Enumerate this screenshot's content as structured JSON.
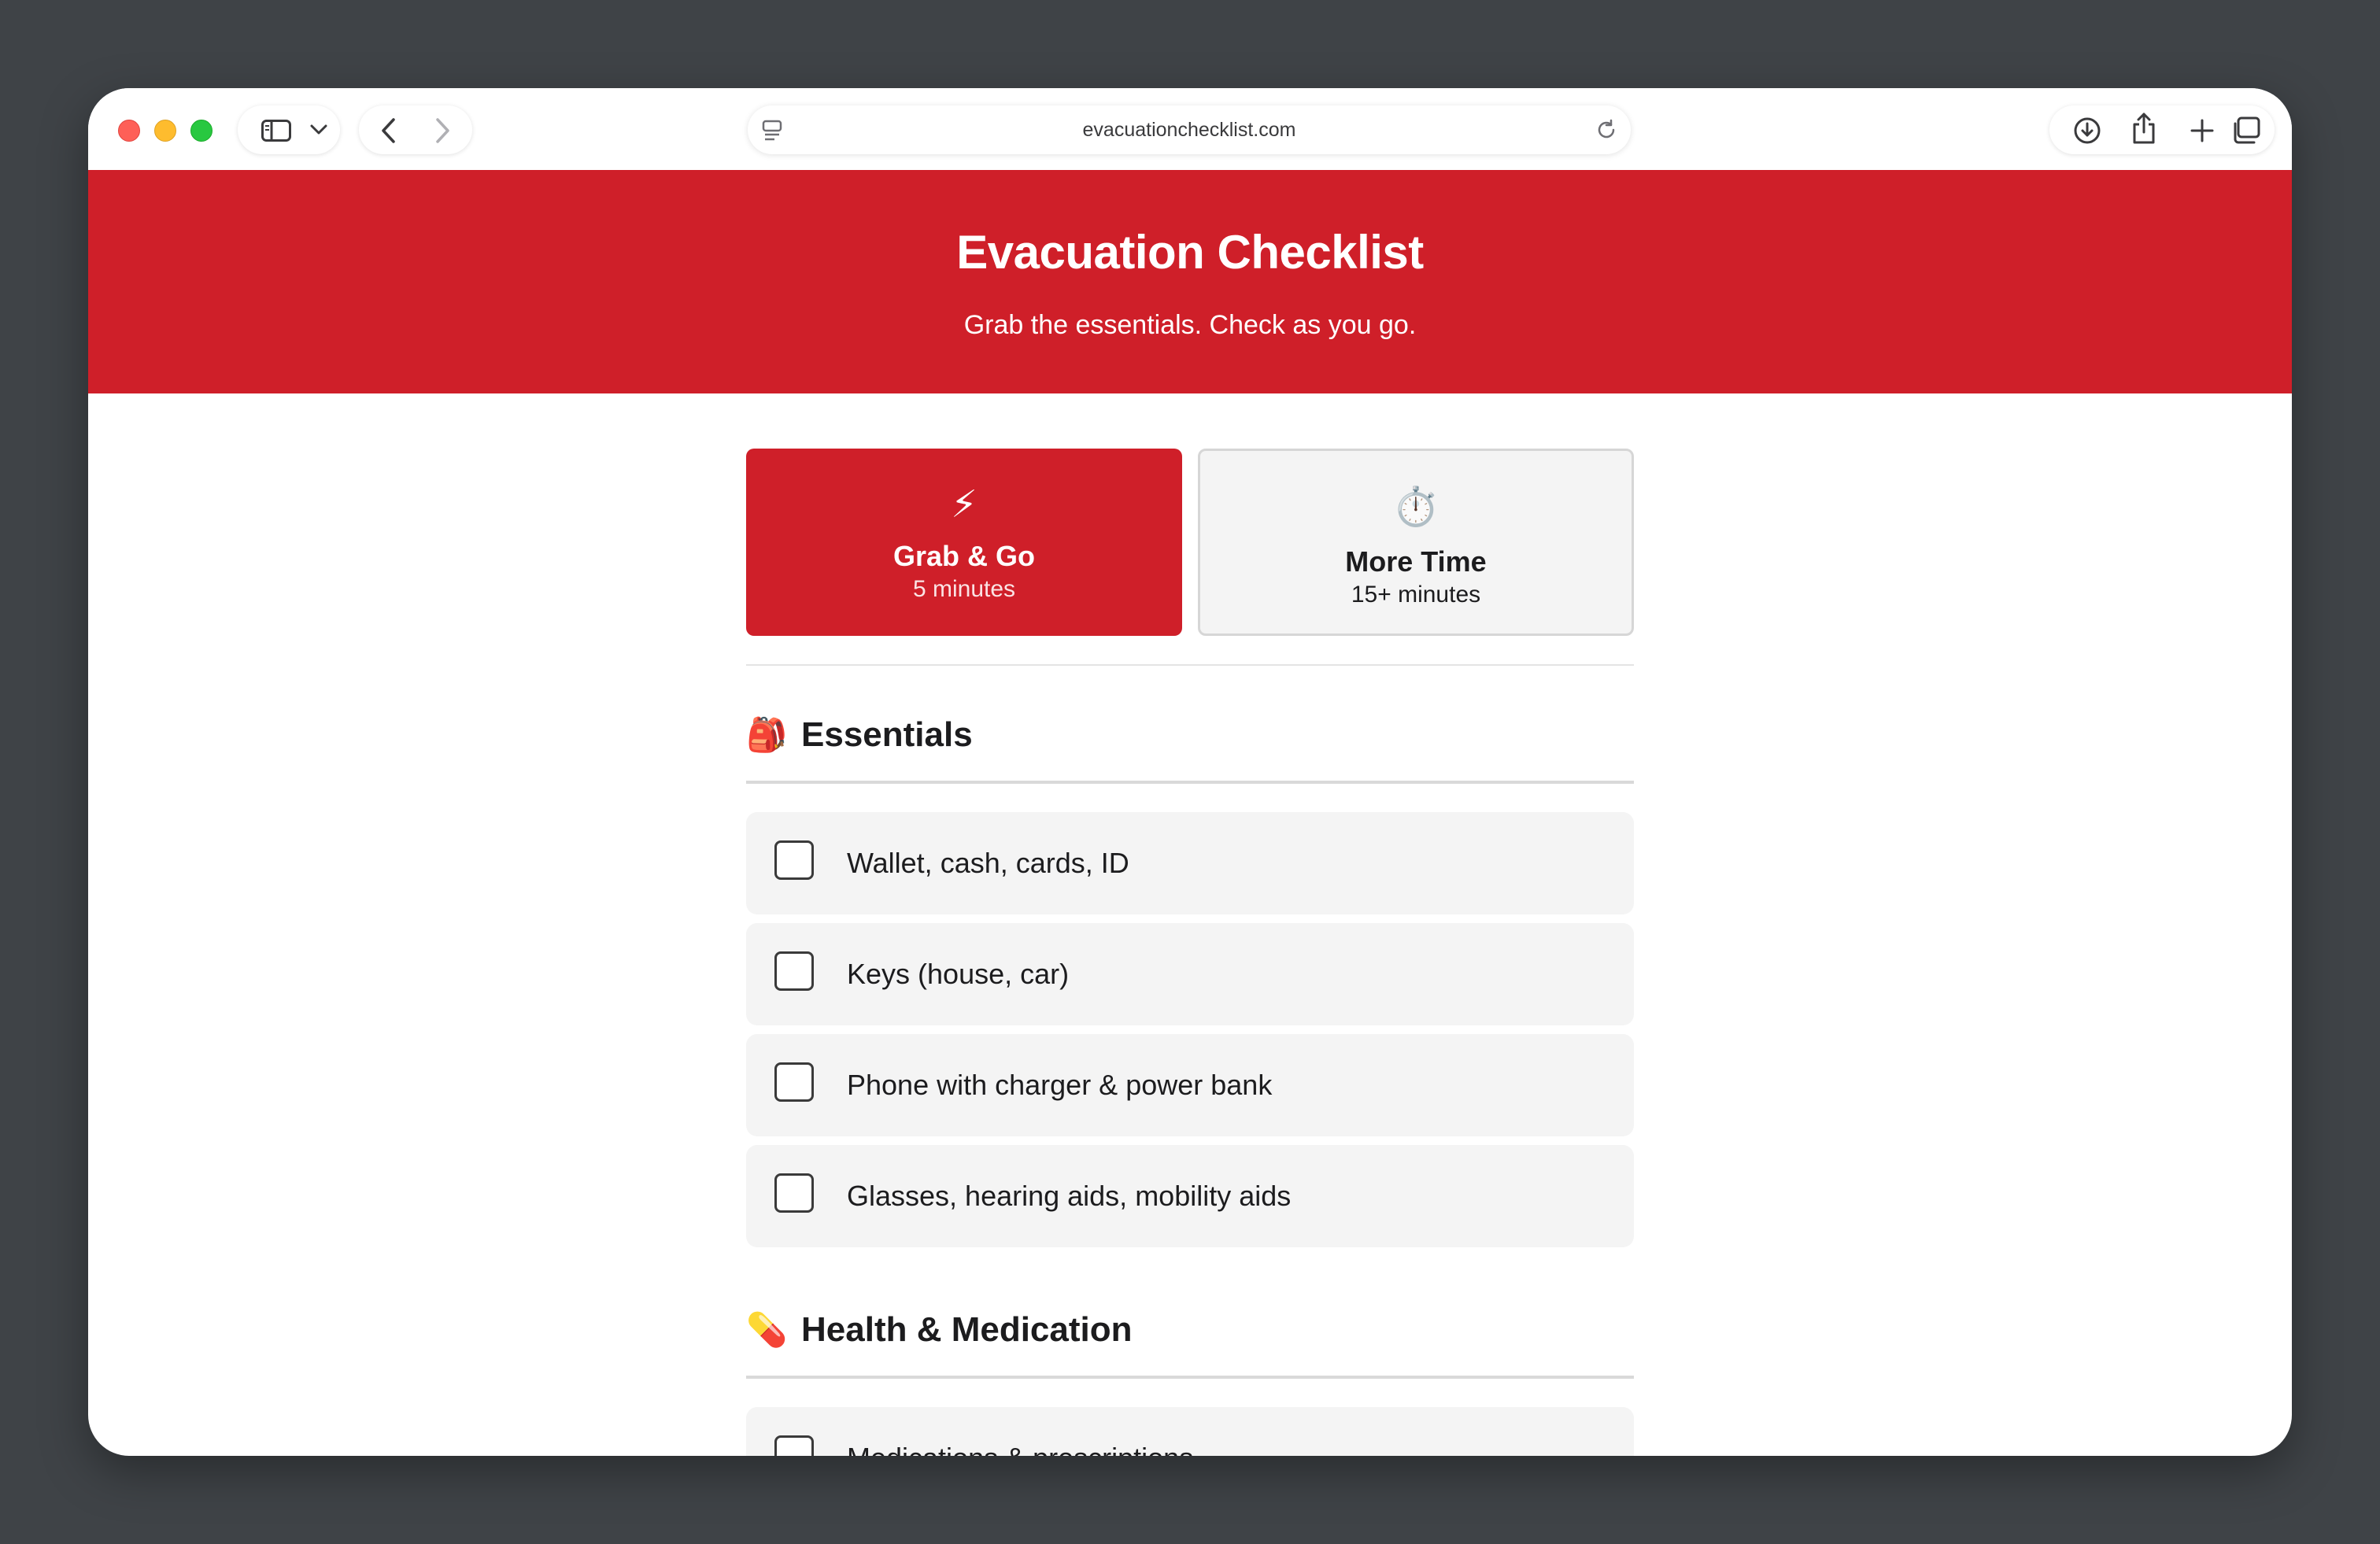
{
  "browser": {
    "url": "evacuationchecklist.com",
    "icons": [
      "sidebar-icon",
      "chevron-down-icon",
      "back-icon",
      "forward-icon",
      "reader-icon",
      "reload-icon",
      "download-icon",
      "share-icon",
      "new-tab-icon",
      "tabs-overview-icon"
    ]
  },
  "header": {
    "title": "Evacuation Checklist",
    "subtitle": "Grab the essentials. Check as you go.",
    "color": "#cf1f29"
  },
  "modes": [
    {
      "icon": "⚡",
      "label": "Grab & Go",
      "sub": "5 minutes",
      "selected": true
    },
    {
      "icon": "⏱️",
      "label": "More Time",
      "sub": "15+ minutes",
      "selected": false
    }
  ],
  "sections": [
    {
      "emoji": "🎒",
      "title": "Essentials",
      "items": [
        {
          "label": "Wallet, cash, cards, ID",
          "checked": false
        },
        {
          "label": "Keys (house, car)",
          "checked": false
        },
        {
          "label": "Phone with charger & power bank",
          "checked": false
        },
        {
          "label": "Glasses, hearing aids, mobility aids",
          "checked": false
        }
      ]
    },
    {
      "emoji": "💊",
      "title": "Health & Medication",
      "items": [
        {
          "label": "Medications & prescriptions",
          "checked": false
        }
      ]
    }
  ]
}
